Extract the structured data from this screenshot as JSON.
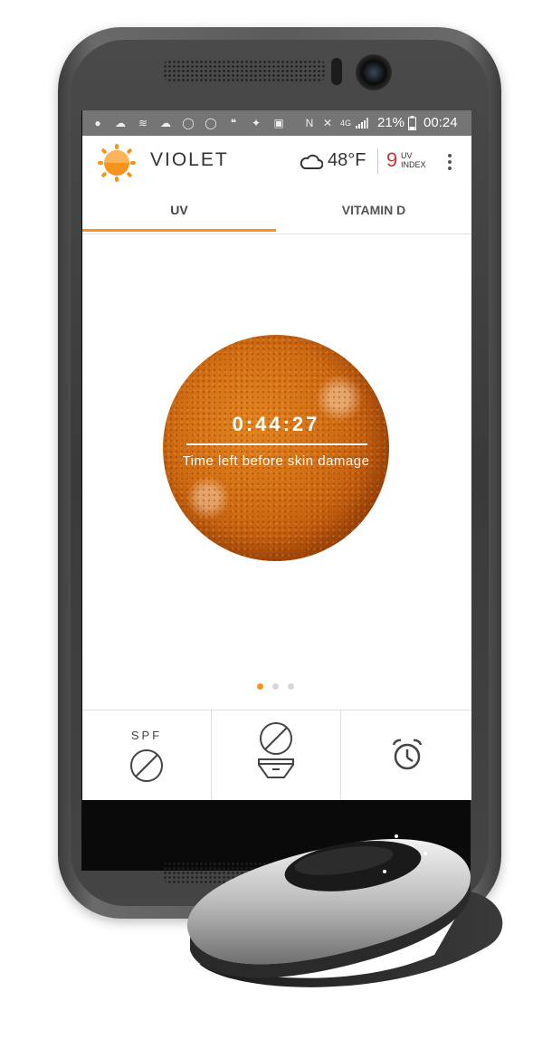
{
  "status_bar": {
    "icons": [
      "chat-icon",
      "cloud-icon",
      "wifi-icon",
      "cloud-icon",
      "whatsapp-icon",
      "messenger-icon",
      "hangouts-icon",
      "twitter-icon",
      "image-icon",
      "nfc-icon",
      "mute-icon",
      "network-icon",
      "signal-icon",
      "battery-icon"
    ],
    "battery_pct": "21%",
    "time": "00:24"
  },
  "app_bar": {
    "title": "VIOLET",
    "temperature": "48°F",
    "uv_value": "9",
    "uv_label_line1": "UV",
    "uv_label_line2": "INDEX",
    "menu_icon": "more-vert-icon"
  },
  "tabs": [
    {
      "label": "UV",
      "active": true
    },
    {
      "label": "VITAMIN D",
      "active": false
    }
  ],
  "main": {
    "timer": "0:44:27",
    "caption": "Time left before skin damage"
  },
  "pager": {
    "count": 3,
    "active": 0
  },
  "bottom": {
    "spf_label": "SPF",
    "spf_icon": "no-sunscreen-icon",
    "clothing_icon": "no-clothing-icon",
    "alarm_icon": "alarm-clock-icon"
  },
  "colors": {
    "accent": "#f7941d",
    "uv_value": "#d32f2f",
    "status_bar": "#757575"
  }
}
